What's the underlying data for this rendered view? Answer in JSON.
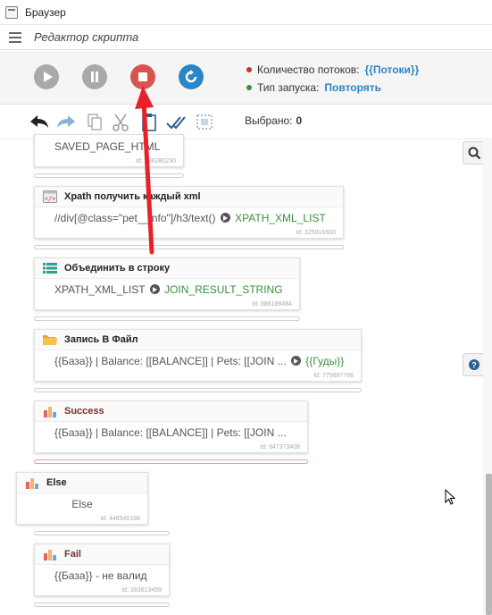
{
  "window": {
    "title": "Браузер"
  },
  "header": {
    "editor_title": "Редактор скрипта"
  },
  "controls": {
    "play": "play-icon",
    "pause": "pause-icon",
    "stop": "stop-icon",
    "restart": "restart-icon"
  },
  "run_info": {
    "threads_label": "Количество потоков:",
    "threads_value": "{{Потоки}}",
    "launch_label": "Тип запуска:",
    "launch_value": "Повторять"
  },
  "edit_bar": {
    "selected_label": "Выбрано:",
    "selected_count": "0"
  },
  "blocks": [
    {
      "title": "",
      "body": "SAVED_PAGE_HTML",
      "id": "Id: 736280230"
    },
    {
      "title": "Xpath получить каждый xml",
      "body": "//div[@class=\"pet__info\"]/h3/text()",
      "out": "XPATH_XML_LIST",
      "id": "Id: 325915600"
    },
    {
      "title": "Объединить в строку",
      "body": "XPATH_XML_LIST",
      "out": "JOIN_RESULT_STRING",
      "id": "Id: 686189484"
    },
    {
      "title": "Запись В Файл",
      "body": "{{База}} | Balance: [[BALANCE]] | Pets: [[JOIN ...",
      "out": "{{Гуды}}",
      "id": "Id: 775697766"
    },
    {
      "title": "Success",
      "body": "{{База}} | Balance: [[BALANCE]] | Pets: [[JOIN ...",
      "id": "Id: 947373408"
    },
    {
      "title": "Else",
      "body": "Else",
      "id": "Id: 446546188"
    },
    {
      "title": "Fail",
      "body": "{{База}} - не валид",
      "id": "Id: 283613459"
    }
  ],
  "colors": {
    "stop": "#d9534f",
    "restart": "#2b86c5",
    "link": "#2b86c5",
    "output_var": "#3a8f3a",
    "annotation_arrow": "#e8202a",
    "success_title": "#7a2e2e"
  }
}
